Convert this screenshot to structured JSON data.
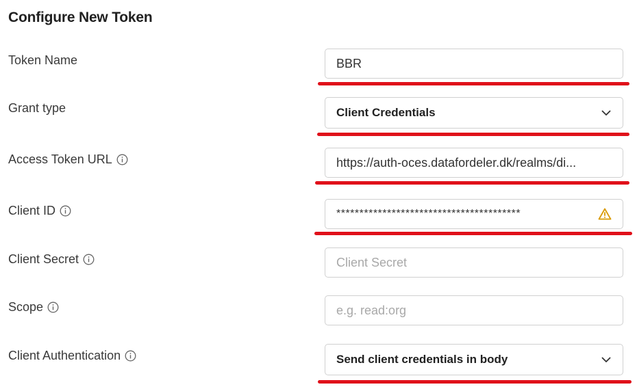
{
  "header": {
    "title": "Configure New Token"
  },
  "fields": {
    "token_name": {
      "label": "Token Name",
      "value": "BBR"
    },
    "grant_type": {
      "label": "Grant type",
      "value": "Client Credentials"
    },
    "access_token_url": {
      "label": "Access Token URL",
      "value": "https://auth-oces.datafordeler.dk/realms/di..."
    },
    "client_id": {
      "label": "Client ID",
      "value": "****************************************"
    },
    "client_secret": {
      "label": "Client Secret",
      "placeholder": "Client Secret"
    },
    "scope": {
      "label": "Scope",
      "placeholder": "e.g. read:org"
    },
    "client_authentication": {
      "label": "Client Authentication",
      "value": "Send client credentials in body"
    }
  },
  "icons": {
    "info": "info-icon",
    "chevron": "chevron-down-icon",
    "warning": "warning-icon"
  },
  "colors": {
    "highlight_underline": "#e0101a",
    "warning": "#d99a00",
    "border": "#d0d0d0"
  }
}
